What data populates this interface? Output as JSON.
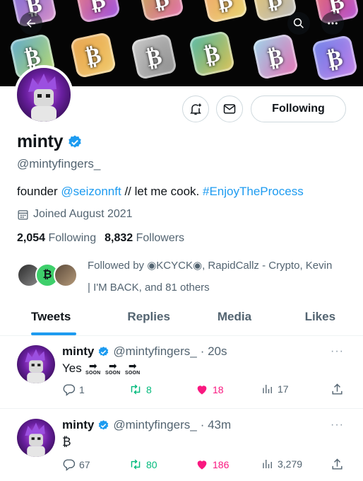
{
  "header": {
    "back_icon": "arrow-left-icon",
    "search_icon": "search-icon",
    "more_icon": "more-horizontal-icon",
    "banner_glyphs": [
      "₿",
      "₿",
      "₿",
      "₿",
      "₿",
      "₿",
      "₿",
      "₿",
      "₿",
      "₿",
      "₿",
      "₿"
    ]
  },
  "profile": {
    "name": "minty",
    "handle": "@mintyfingers_",
    "follow_label": "Following",
    "bio_prefix": "founder",
    "bio_mention": "@seizonnft",
    "bio_middle": "// let me cook.",
    "bio_hashtag": "#EnjoyTheProcess",
    "joined": "Joined August 2021",
    "following_count": "2,054",
    "following_label": "Following",
    "followers_count": "8,832",
    "followers_label": "Followers",
    "followed_by_line1": "Followed by ◉KCYCK◉, RapidCallz - Crypto, Kevin",
    "followed_by_line2": "| I'M BACK, and 81 others",
    "mini_avatar_glyph": "₿"
  },
  "tabs": [
    {
      "label": "Tweets",
      "active": true
    },
    {
      "label": "Replies",
      "active": false
    },
    {
      "label": "Media",
      "active": false
    },
    {
      "label": "Likes",
      "active": false
    }
  ],
  "tweets": [
    {
      "name": "minty",
      "handle": "@mintyfingers_",
      "time": "· 20s",
      "more": "···",
      "text": "Yes",
      "soon_arrows": [
        "➡",
        "➡",
        "➡"
      ],
      "soon_labels": [
        "SOON",
        "SOON",
        "SOON"
      ],
      "replies": "1",
      "retweets": "8",
      "likes": "18",
      "views": "17"
    },
    {
      "name": "minty",
      "handle": "@mintyfingers_",
      "time": "· 43m",
      "more": "···",
      "text": "₿",
      "replies": "67",
      "retweets": "80",
      "likes": "186",
      "views": "3,279"
    }
  ],
  "colors": {
    "accent": "#1d9bf0",
    "retweet": "#00ba7c",
    "like": "#f91880",
    "secondary_text": "#536471",
    "verified": "#1d9bf0"
  }
}
